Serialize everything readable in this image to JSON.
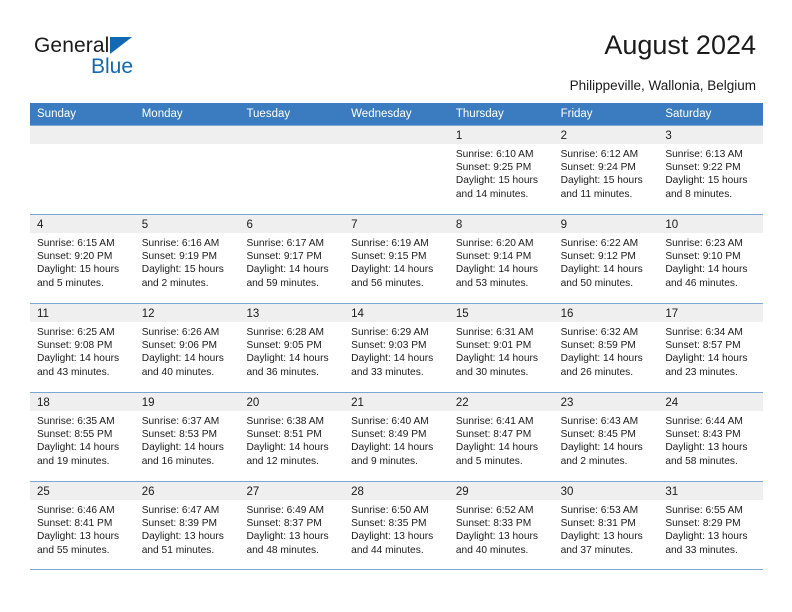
{
  "logo": {
    "word_one": "General",
    "word_two": "Blue",
    "triangle_color": "#1268b3",
    "text_color": "#1b1b1b"
  },
  "header": {
    "title": "August 2024",
    "subtitle": "Philippeville, Wallonia, Belgium"
  },
  "calendar": {
    "header_bg": "#3a7cbf",
    "header_text_color": "#ffffff",
    "daynum_band_bg": "#efefef",
    "row_separator_color": "#7ba7d0",
    "weekdays": [
      "Sunday",
      "Monday",
      "Tuesday",
      "Wednesday",
      "Thursday",
      "Friday",
      "Saturday"
    ],
    "weeks": [
      [
        {
          "day": "",
          "sunrise": "",
          "sunset": "",
          "daylight": ""
        },
        {
          "day": "",
          "sunrise": "",
          "sunset": "",
          "daylight": ""
        },
        {
          "day": "",
          "sunrise": "",
          "sunset": "",
          "daylight": ""
        },
        {
          "day": "",
          "sunrise": "",
          "sunset": "",
          "daylight": ""
        },
        {
          "day": "1",
          "sunrise": "Sunrise: 6:10 AM",
          "sunset": "Sunset: 9:25 PM",
          "daylight": "Daylight: 15 hours and 14 minutes."
        },
        {
          "day": "2",
          "sunrise": "Sunrise: 6:12 AM",
          "sunset": "Sunset: 9:24 PM",
          "daylight": "Daylight: 15 hours and 11 minutes."
        },
        {
          "day": "3",
          "sunrise": "Sunrise: 6:13 AM",
          "sunset": "Sunset: 9:22 PM",
          "daylight": "Daylight: 15 hours and 8 minutes."
        }
      ],
      [
        {
          "day": "4",
          "sunrise": "Sunrise: 6:15 AM",
          "sunset": "Sunset: 9:20 PM",
          "daylight": "Daylight: 15 hours and 5 minutes."
        },
        {
          "day": "5",
          "sunrise": "Sunrise: 6:16 AM",
          "sunset": "Sunset: 9:19 PM",
          "daylight": "Daylight: 15 hours and 2 minutes."
        },
        {
          "day": "6",
          "sunrise": "Sunrise: 6:17 AM",
          "sunset": "Sunset: 9:17 PM",
          "daylight": "Daylight: 14 hours and 59 minutes."
        },
        {
          "day": "7",
          "sunrise": "Sunrise: 6:19 AM",
          "sunset": "Sunset: 9:15 PM",
          "daylight": "Daylight: 14 hours and 56 minutes."
        },
        {
          "day": "8",
          "sunrise": "Sunrise: 6:20 AM",
          "sunset": "Sunset: 9:14 PM",
          "daylight": "Daylight: 14 hours and 53 minutes."
        },
        {
          "day": "9",
          "sunrise": "Sunrise: 6:22 AM",
          "sunset": "Sunset: 9:12 PM",
          "daylight": "Daylight: 14 hours and 50 minutes."
        },
        {
          "day": "10",
          "sunrise": "Sunrise: 6:23 AM",
          "sunset": "Sunset: 9:10 PM",
          "daylight": "Daylight: 14 hours and 46 minutes."
        }
      ],
      [
        {
          "day": "11",
          "sunrise": "Sunrise: 6:25 AM",
          "sunset": "Sunset: 9:08 PM",
          "daylight": "Daylight: 14 hours and 43 minutes."
        },
        {
          "day": "12",
          "sunrise": "Sunrise: 6:26 AM",
          "sunset": "Sunset: 9:06 PM",
          "daylight": "Daylight: 14 hours and 40 minutes."
        },
        {
          "day": "13",
          "sunrise": "Sunrise: 6:28 AM",
          "sunset": "Sunset: 9:05 PM",
          "daylight": "Daylight: 14 hours and 36 minutes."
        },
        {
          "day": "14",
          "sunrise": "Sunrise: 6:29 AM",
          "sunset": "Sunset: 9:03 PM",
          "daylight": "Daylight: 14 hours and 33 minutes."
        },
        {
          "day": "15",
          "sunrise": "Sunrise: 6:31 AM",
          "sunset": "Sunset: 9:01 PM",
          "daylight": "Daylight: 14 hours and 30 minutes."
        },
        {
          "day": "16",
          "sunrise": "Sunrise: 6:32 AM",
          "sunset": "Sunset: 8:59 PM",
          "daylight": "Daylight: 14 hours and 26 minutes."
        },
        {
          "day": "17",
          "sunrise": "Sunrise: 6:34 AM",
          "sunset": "Sunset: 8:57 PM",
          "daylight": "Daylight: 14 hours and 23 minutes."
        }
      ],
      [
        {
          "day": "18",
          "sunrise": "Sunrise: 6:35 AM",
          "sunset": "Sunset: 8:55 PM",
          "daylight": "Daylight: 14 hours and 19 minutes."
        },
        {
          "day": "19",
          "sunrise": "Sunrise: 6:37 AM",
          "sunset": "Sunset: 8:53 PM",
          "daylight": "Daylight: 14 hours and 16 minutes."
        },
        {
          "day": "20",
          "sunrise": "Sunrise: 6:38 AM",
          "sunset": "Sunset: 8:51 PM",
          "daylight": "Daylight: 14 hours and 12 minutes."
        },
        {
          "day": "21",
          "sunrise": "Sunrise: 6:40 AM",
          "sunset": "Sunset: 8:49 PM",
          "daylight": "Daylight: 14 hours and 9 minutes."
        },
        {
          "day": "22",
          "sunrise": "Sunrise: 6:41 AM",
          "sunset": "Sunset: 8:47 PM",
          "daylight": "Daylight: 14 hours and 5 minutes."
        },
        {
          "day": "23",
          "sunrise": "Sunrise: 6:43 AM",
          "sunset": "Sunset: 8:45 PM",
          "daylight": "Daylight: 14 hours and 2 minutes."
        },
        {
          "day": "24",
          "sunrise": "Sunrise: 6:44 AM",
          "sunset": "Sunset: 8:43 PM",
          "daylight": "Daylight: 13 hours and 58 minutes."
        }
      ],
      [
        {
          "day": "25",
          "sunrise": "Sunrise: 6:46 AM",
          "sunset": "Sunset: 8:41 PM",
          "daylight": "Daylight: 13 hours and 55 minutes."
        },
        {
          "day": "26",
          "sunrise": "Sunrise: 6:47 AM",
          "sunset": "Sunset: 8:39 PM",
          "daylight": "Daylight: 13 hours and 51 minutes."
        },
        {
          "day": "27",
          "sunrise": "Sunrise: 6:49 AM",
          "sunset": "Sunset: 8:37 PM",
          "daylight": "Daylight: 13 hours and 48 minutes."
        },
        {
          "day": "28",
          "sunrise": "Sunrise: 6:50 AM",
          "sunset": "Sunset: 8:35 PM",
          "daylight": "Daylight: 13 hours and 44 minutes."
        },
        {
          "day": "29",
          "sunrise": "Sunrise: 6:52 AM",
          "sunset": "Sunset: 8:33 PM",
          "daylight": "Daylight: 13 hours and 40 minutes."
        },
        {
          "day": "30",
          "sunrise": "Sunrise: 6:53 AM",
          "sunset": "Sunset: 8:31 PM",
          "daylight": "Daylight: 13 hours and 37 minutes."
        },
        {
          "day": "31",
          "sunrise": "Sunrise: 6:55 AM",
          "sunset": "Sunset: 8:29 PM",
          "daylight": "Daylight: 13 hours and 33 minutes."
        }
      ]
    ]
  }
}
